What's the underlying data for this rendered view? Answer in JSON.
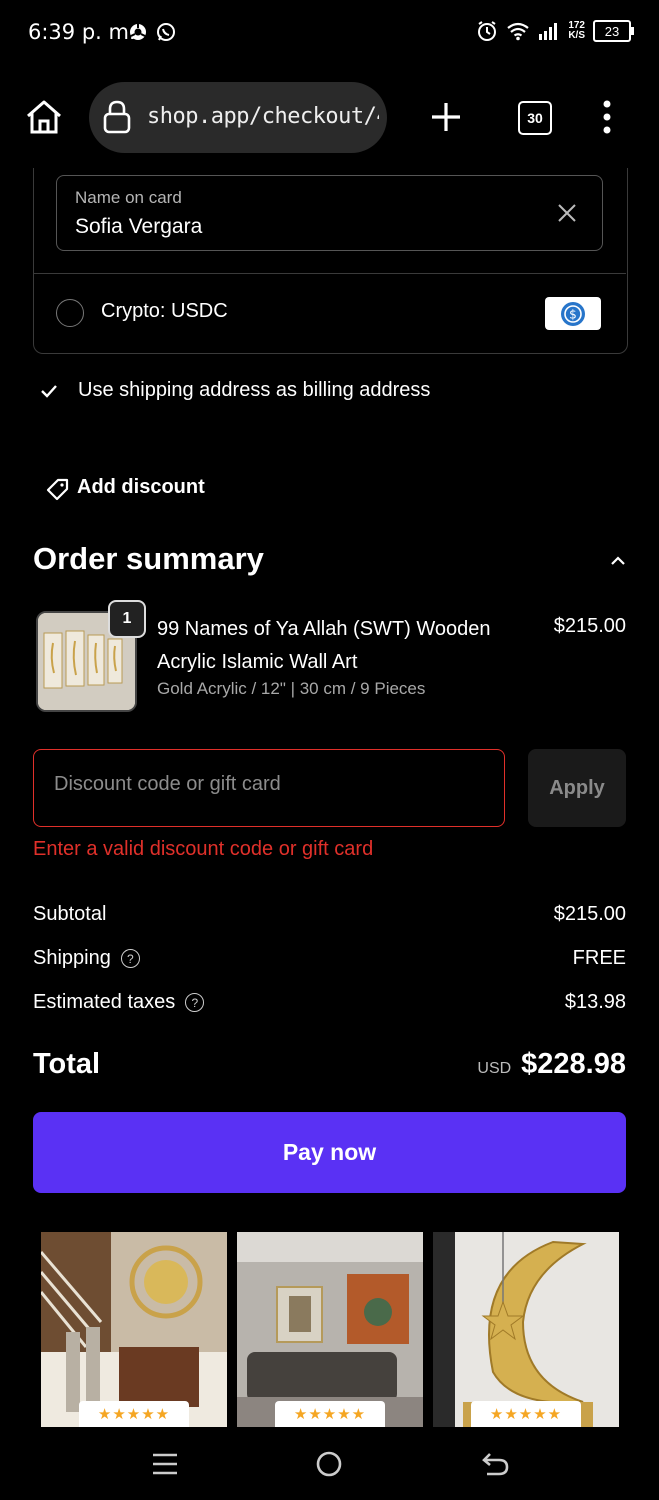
{
  "status_bar": {
    "time": "6:39 p. m.",
    "net_speed_top": "172",
    "net_speed_bottom": "K/S",
    "battery": "23"
  },
  "browser": {
    "url": "shop.app/checkout/4",
    "tab_count": "30"
  },
  "card_form": {
    "name_label": "Name on card",
    "name_value": "Sofia Vergara"
  },
  "payment_options": {
    "crypto_label": "Crypto: USDC"
  },
  "billing": {
    "same_as_shipping_label": "Use shipping address as billing address"
  },
  "discount_link": "Add discount",
  "order_summary": {
    "title": "Order summary",
    "item": {
      "quantity": "1",
      "name": "99 Names of Ya Allah (SWT) Wooden Acrylic Islamic Wall Art",
      "variant": "Gold Acrylic / 12\" | 30 cm / 9 Pieces",
      "price": "$215.00"
    },
    "discount": {
      "placeholder": "Discount code or gift card",
      "apply_label": "Apply",
      "error": "Enter a valid discount code or gift card"
    },
    "subtotal_label": "Subtotal",
    "subtotal_value": "$215.00",
    "shipping_label": "Shipping",
    "shipping_value": "FREE",
    "taxes_label": "Estimated taxes",
    "taxes_value": "$13.98",
    "total_label": "Total",
    "total_currency": "USD",
    "total_value": "$228.98"
  },
  "pay_button": "Pay now",
  "recommendations": [
    {
      "rating": 5,
      "stars": "★★★★★"
    },
    {
      "rating": 5,
      "stars": "★★★★★"
    },
    {
      "rating": 5,
      "stars": "★★★★★"
    }
  ],
  "colors": {
    "accent": "#5a31f4",
    "error": "#e0302a",
    "background": "#000000"
  }
}
